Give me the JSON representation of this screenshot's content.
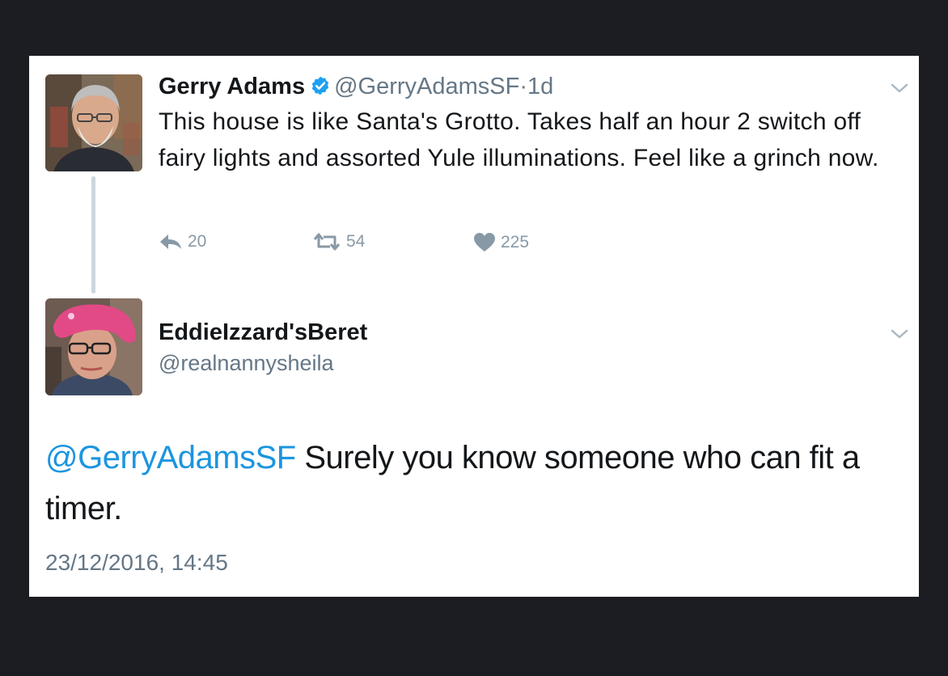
{
  "tweet1": {
    "name": "Gerry Adams",
    "handle": "@GerryAdamsSF",
    "separator": "·",
    "age": "1d",
    "text": "This house is like Santa's Grotto. Takes half an hour 2 switch off fairy lights and assorted Yule illuminations. Feel like a grinch now.",
    "replies": "20",
    "retweets": "54",
    "likes": "225"
  },
  "tweet2": {
    "name": "EddieIzzard'sBeret",
    "handle": "@realnannysheila",
    "mention": "@GerryAdamsSF",
    "text": " Surely you know someone who can fit a timer.",
    "timestamp": "23/12/2016, 14:45"
  },
  "colors": {
    "link_blue": "#1b95e0",
    "verified_blue": "#1da1f2",
    "secondary_gray": "#657786",
    "action_gray": "#8899a6",
    "background": "#1b1d22"
  },
  "icons": {
    "verified": "verified-badge-icon",
    "reply": "reply-icon",
    "retweet": "retweet-icon",
    "like": "heart-icon",
    "menu": "chevron-down-icon"
  }
}
